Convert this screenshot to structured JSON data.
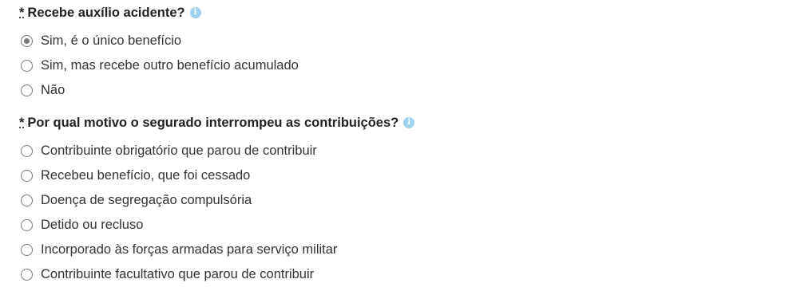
{
  "questions": [
    {
      "required_mark": "*",
      "label": "Recebe auxílio acidente?",
      "info_icon": "info-icon",
      "selected_index": 0,
      "options": [
        "Sim, é o único benefício",
        "Sim, mas recebe outro benefício acumulado",
        "Não"
      ]
    },
    {
      "required_mark": "*",
      "label": "Por qual motivo o segurado interrompeu as contribuições?",
      "info_icon": "info-icon",
      "selected_index": null,
      "options": [
        "Contribuinte obrigatório que parou de contribuir",
        "Recebeu benefício, que foi cessado",
        "Doença de segregação compulsória",
        "Detido ou recluso",
        "Incorporado às forças armadas para serviço militar",
        "Contribuinte facultativo que parou de contribuir"
      ]
    }
  ],
  "colors": {
    "info_icon": "#9fd0ef",
    "radio_border": "#7a7a7a",
    "text": "#333333"
  }
}
